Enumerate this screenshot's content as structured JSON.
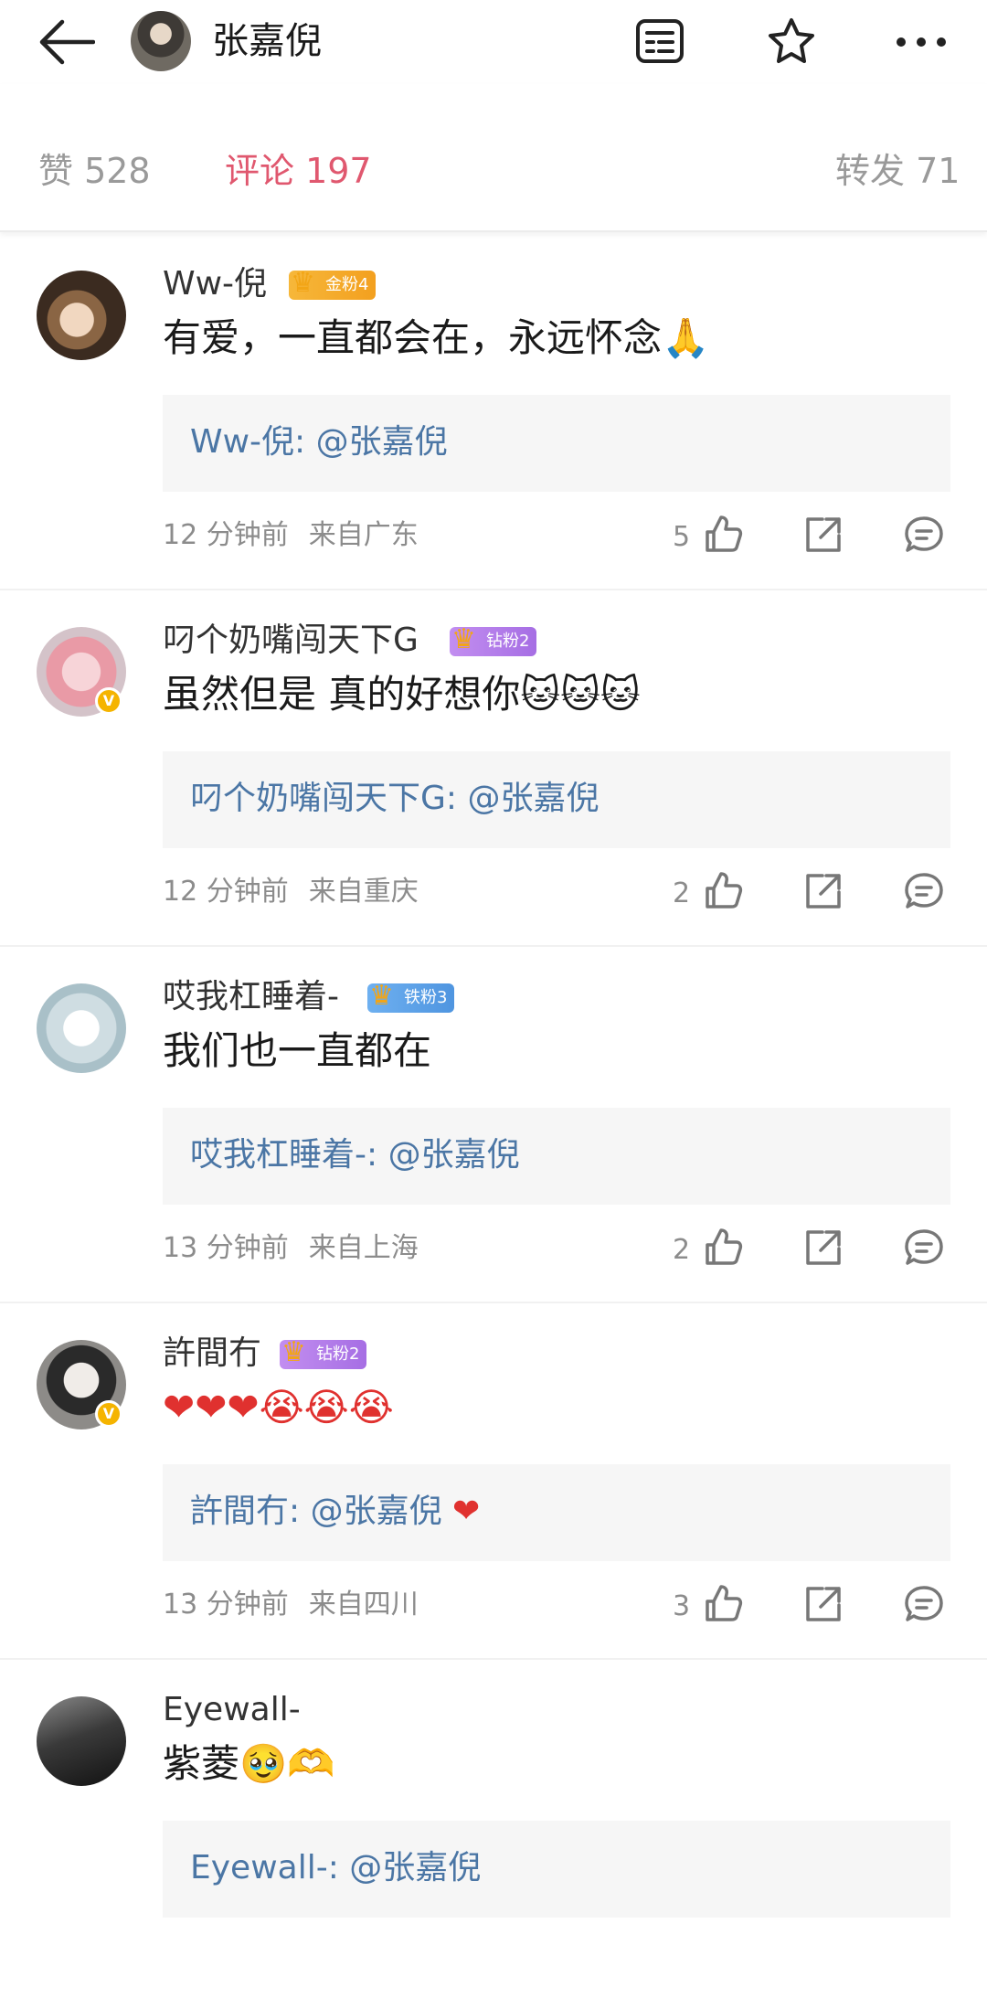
{
  "header": {
    "username": "张嘉倪",
    "icons": [
      "back-arrow-icon",
      "list-icon",
      "star-icon",
      "more-icon"
    ]
  },
  "tabs": [
    {
      "label": "赞 528",
      "active": false
    },
    {
      "label": "评论 197",
      "active": true
    },
    {
      "label": "转发 71",
      "active": false
    }
  ],
  "colors": {
    "accent": "#e0586f",
    "link": "#4b76a5",
    "gold_badge": "#f5a623",
    "diamond_badge": "#b980e8",
    "iron_badge": "#5da0e8"
  },
  "comments": [
    {
      "user": "Ww-倪",
      "badge": "金粉4",
      "text": "有爱，一直都会在，永远怀念🙏",
      "ref_user": "Ww-倪",
      "ref_mention": ": @张嘉倪",
      "ref_extra": "",
      "time": "12 分钟前",
      "location": "来自广东",
      "likes": "5"
    },
    {
      "user": "叼个奶嘴闯天下G",
      "badge": "钻粉2",
      "text": "虽然但是 真的好想你🐱🐱🐱",
      "ref_user": "叼个奶嘴闯天下G",
      "ref_mention": ": @张嘉倪",
      "ref_extra": "",
      "time": "12 分钟前",
      "location": "来自重庆",
      "likes": "2"
    },
    {
      "user": "哎我杠睡着-",
      "badge": "铁粉3",
      "text": "我们也一直都在",
      "ref_user": "哎我杠睡着-",
      "ref_mention": ": @张嘉倪",
      "ref_extra": "",
      "time": "13 分钟前",
      "location": "来自上海",
      "likes": "2"
    },
    {
      "user": "許間冇",
      "badge": "钻粉2",
      "text": "❤❤❤😭😭😭",
      "ref_user": "許間冇",
      "ref_mention": ": @张嘉倪",
      "ref_extra": "❤",
      "time": "13 分钟前",
      "location": "来自四川",
      "likes": "3"
    },
    {
      "user": "Eyewall-",
      "badge": "",
      "text": "紫菱🥹🫶",
      "ref_user": "Eyewall-",
      "ref_mention": ": @张嘉倪",
      "ref_extra": "",
      "time": "",
      "location": "",
      "likes": ""
    }
  ]
}
